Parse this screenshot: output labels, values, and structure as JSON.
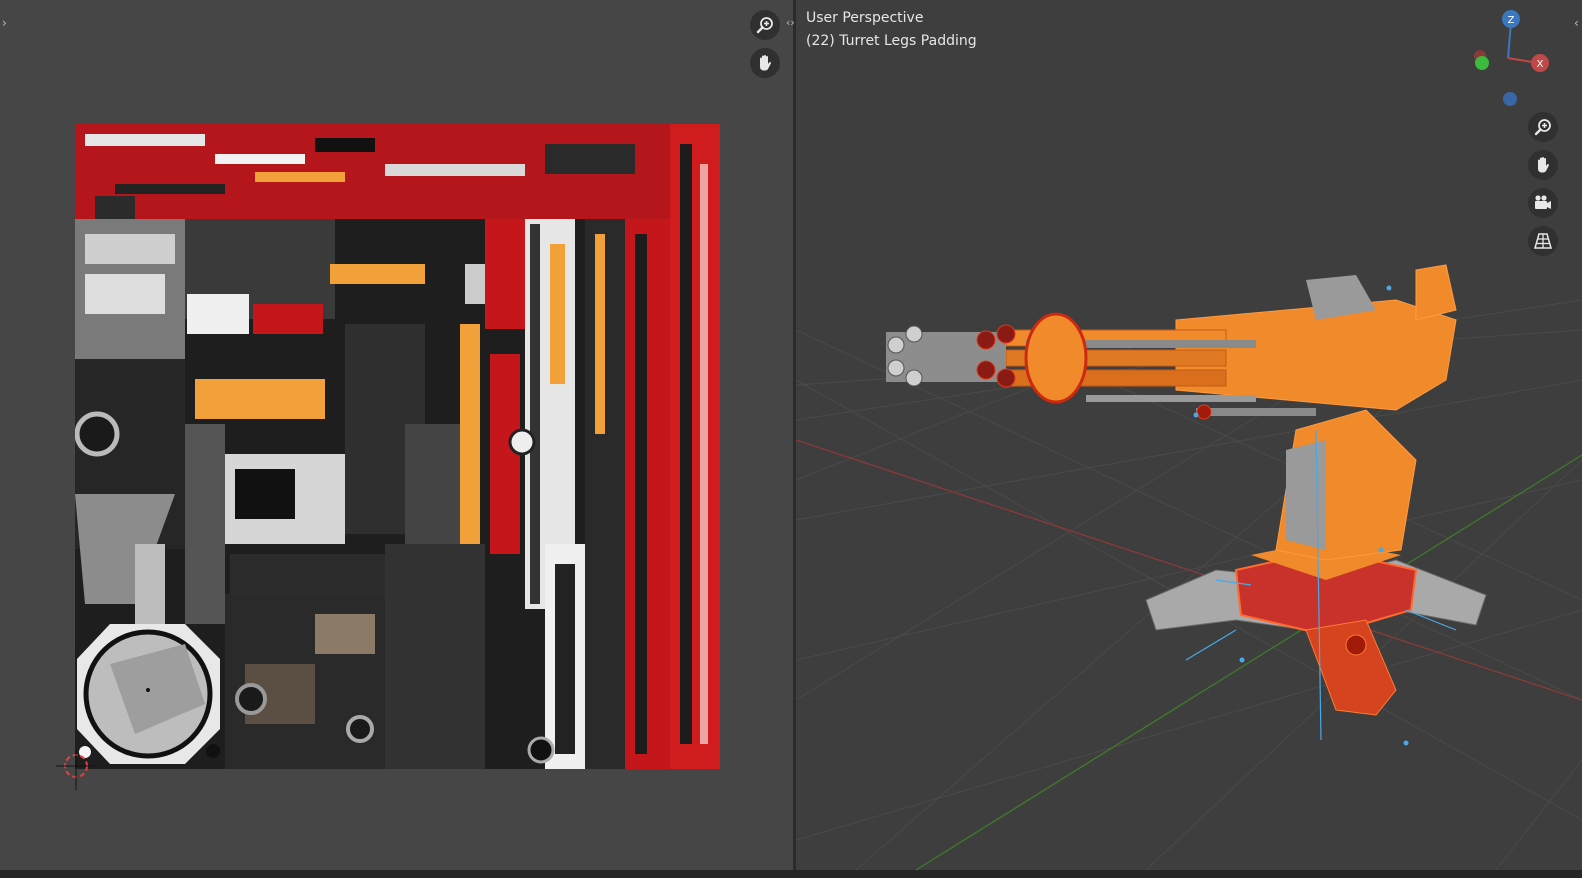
{
  "colors": {
    "uv_bg": "#464646",
    "viewport_bg": "#3e3e3e",
    "axis_x": "#c04848",
    "axis_y": "#5a9a3a",
    "axis_z": "#3a78c0",
    "selection_orange": "#f08a2a",
    "selection_red": "#cc2a10"
  },
  "uv_editor": {
    "zoom_icon": "magnifier-plus-icon",
    "pan_icon": "hand-icon",
    "cursor_icon": "2d-cursor-icon"
  },
  "viewport": {
    "view_name": "User Perspective",
    "object_info": "(22) Turret Legs Padding",
    "gizmo": {
      "x": "X",
      "y": "Y",
      "z": "Z"
    },
    "nav_icons": [
      "magnifier-plus-icon",
      "hand-icon",
      "camera-icon",
      "grid-perspective-icon"
    ]
  }
}
